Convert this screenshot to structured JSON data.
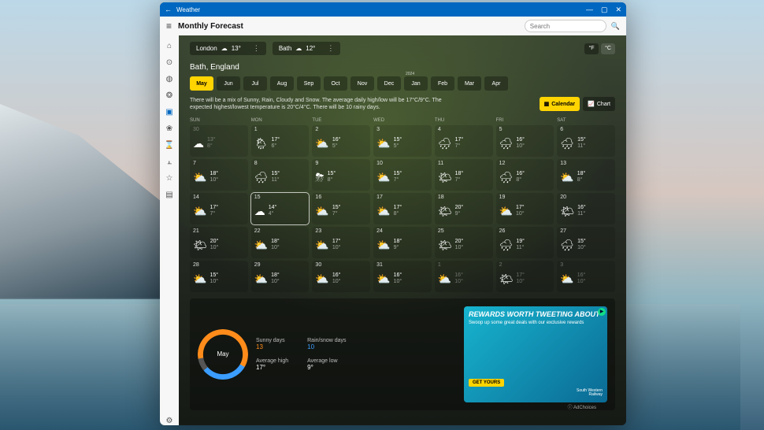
{
  "window": {
    "title": "Weather",
    "back_glyph": "←",
    "controls": {
      "min": "—",
      "max": "▢",
      "close": "✕"
    }
  },
  "header": {
    "heading": "Monthly Forecast",
    "search_placeholder": "Search"
  },
  "sidebar": {
    "items": [
      {
        "name": "home-icon",
        "glyph": "⌂"
      },
      {
        "name": "map-icon",
        "glyph": "⊙"
      },
      {
        "name": "globe-icon",
        "glyph": "◍"
      },
      {
        "name": "life-icon",
        "glyph": "❂"
      },
      {
        "name": "calendar-icon",
        "glyph": "▣",
        "active": true
      },
      {
        "name": "pollen-icon",
        "glyph": "❀"
      },
      {
        "name": "history-icon",
        "glyph": "⌛"
      },
      {
        "name": "chart-icon",
        "glyph": "⫠"
      },
      {
        "name": "favorites-icon",
        "glyph": "☆"
      },
      {
        "name": "news-icon",
        "glyph": "▤"
      }
    ],
    "footer": [
      {
        "name": "settings-icon",
        "glyph": "⚙"
      }
    ]
  },
  "cities": [
    {
      "name": "London",
      "icon": "☁",
      "temp": "13°"
    },
    {
      "name": "Bath",
      "icon": "☁",
      "temp": "12°"
    }
  ],
  "units": {
    "f": "°F",
    "c": "°C",
    "active": "c"
  },
  "location": "Bath, England",
  "months": {
    "labels": [
      "May",
      "Jun",
      "Jul",
      "Aug",
      "Sep",
      "Oct",
      "Nov",
      "Dec",
      "Jan",
      "Feb",
      "Mar",
      "Apr"
    ],
    "active": "May",
    "year_note_on": "Jan",
    "year_note": "2024"
  },
  "summary": "There will be a mix of Sunny, Rain, Cloudy and Snow. The average daily high/low will be 17°C/9°C. The expected highest/lowest temperature is 20°C/4°C. There will be 10 rainy days.",
  "view": {
    "calendar": "Calendar",
    "chart": "Chart",
    "active": "calendar"
  },
  "dow": [
    "SUN",
    "MON",
    "TUE",
    "WED",
    "THU",
    "FRI",
    "SAT"
  ],
  "calendar": [
    [
      {
        "d": "30",
        "hi": "13°",
        "lo": "8°",
        "dim": true,
        "icon": "☁"
      },
      {
        "d": "1",
        "hi": "17°",
        "lo": "6°",
        "icon": "🌦"
      },
      {
        "d": "2",
        "hi": "16°",
        "lo": "5°",
        "icon": "⛅"
      },
      {
        "d": "3",
        "hi": "15°",
        "lo": "5°",
        "icon": "⛅"
      },
      {
        "d": "4",
        "hi": "17°",
        "lo": "7°",
        "icon": "🌧"
      },
      {
        "d": "5",
        "hi": "16°",
        "lo": "10°",
        "icon": "🌧"
      },
      {
        "d": "6",
        "hi": "15°",
        "lo": "11°",
        "icon": "🌧"
      }
    ],
    [
      {
        "d": "7",
        "hi": "18°",
        "lo": "10°",
        "icon": "⛅"
      },
      {
        "d": "8",
        "hi": "15°",
        "lo": "11°",
        "icon": "🌧"
      },
      {
        "d": "9",
        "hi": "15°",
        "lo": "8°",
        "icon": "⛈"
      },
      {
        "d": "10",
        "hi": "15°",
        "lo": "7°",
        "icon": "⛅"
      },
      {
        "d": "11",
        "hi": "18°",
        "lo": "7°",
        "icon": "🌤"
      },
      {
        "d": "12",
        "hi": "16°",
        "lo": "8°",
        "icon": "🌧"
      },
      {
        "d": "13",
        "hi": "18°",
        "lo": "8°",
        "icon": "⛅"
      }
    ],
    [
      {
        "d": "14",
        "hi": "17°",
        "lo": "7°",
        "icon": "⛅"
      },
      {
        "d": "15",
        "hi": "14°",
        "lo": "4°",
        "icon": "☁",
        "highlight": true
      },
      {
        "d": "16",
        "hi": "15°",
        "lo": "7°",
        "icon": "⛅"
      },
      {
        "d": "17",
        "hi": "17°",
        "lo": "8°",
        "icon": "⛅"
      },
      {
        "d": "18",
        "hi": "20°",
        "lo": "9°",
        "icon": "🌤"
      },
      {
        "d": "19",
        "hi": "17°",
        "lo": "10°",
        "icon": "⛅"
      },
      {
        "d": "20",
        "hi": "16°",
        "lo": "11°",
        "icon": "🌤"
      }
    ],
    [
      {
        "d": "21",
        "hi": "20°",
        "lo": "10°",
        "icon": "🌤"
      },
      {
        "d": "22",
        "hi": "18°",
        "lo": "10°",
        "icon": "⛅"
      },
      {
        "d": "23",
        "hi": "17°",
        "lo": "10°",
        "icon": "⛅"
      },
      {
        "d": "24",
        "hi": "18°",
        "lo": "9°",
        "icon": "⛅"
      },
      {
        "d": "25",
        "hi": "20°",
        "lo": "10°",
        "icon": "🌤"
      },
      {
        "d": "26",
        "hi": "19°",
        "lo": "11°",
        "icon": "🌧"
      },
      {
        "d": "27",
        "hi": "15°",
        "lo": "10°",
        "icon": "🌧"
      }
    ],
    [
      {
        "d": "28",
        "hi": "15°",
        "lo": "10°",
        "icon": "⛅"
      },
      {
        "d": "29",
        "hi": "18°",
        "lo": "10°",
        "icon": "⛅"
      },
      {
        "d": "30",
        "hi": "16°",
        "lo": "10°",
        "icon": "⛅"
      },
      {
        "d": "31",
        "hi": "16°",
        "lo": "10°",
        "icon": "⛅"
      },
      {
        "d": "1",
        "hi": "16°",
        "lo": "10°",
        "dim": true,
        "icon": "⛅"
      },
      {
        "d": "2",
        "hi": "17°",
        "lo": "10°",
        "dim": true,
        "icon": "🌤"
      },
      {
        "d": "3",
        "hi": "16°",
        "lo": "10°",
        "dim": true,
        "icon": "⛅"
      }
    ]
  ],
  "stats": {
    "month_label": "May",
    "metrics": {
      "sunny_label": "Sunny days",
      "sunny_val": "13",
      "rain_label": "Rain/snow days",
      "rain_val": "10",
      "avghi_label": "Average high",
      "avghi_val": "17°",
      "avglo_label": "Average low",
      "avglo_val": "9°"
    }
  },
  "ad": {
    "headline": "REWARDS WORTH TWEETING ABOUT",
    "sub": "Swoop up some great deals with our exclusive rewards",
    "cta": "GET YOURS",
    "brand_line1": "South Western",
    "brand_line2": "Railway",
    "adchoices": "AdChoices"
  }
}
